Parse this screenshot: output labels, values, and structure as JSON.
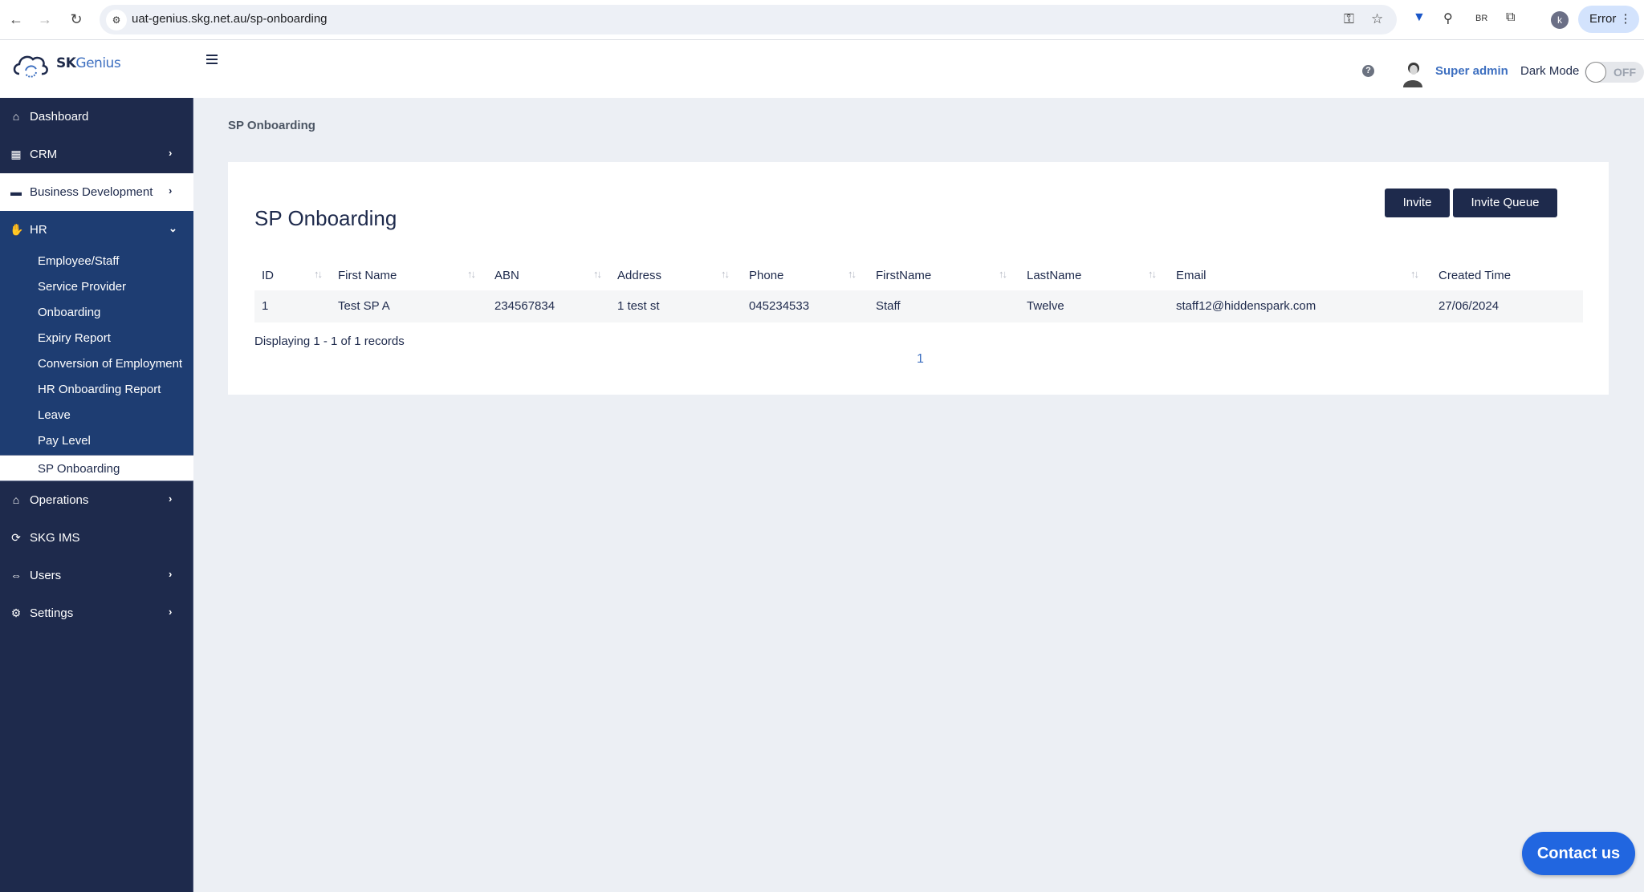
{
  "browser": {
    "url": "uat-genius.skg.net.au/sp-onboarding",
    "profile_initial": "k",
    "error_label": "Error",
    "ext_br_label": "BR"
  },
  "header": {
    "logo_text_a": "SK",
    "logo_text_b": "Genius",
    "help_glyph": "?",
    "user_name": "Super admin",
    "dark_mode_label": "Dark Mode",
    "dark_mode_state": "OFF"
  },
  "sidebar": {
    "items": [
      {
        "label": "Dashboard",
        "icon": "home-icon",
        "glyph": "⌂"
      },
      {
        "label": "CRM",
        "icon": "building-icon",
        "glyph": "▦",
        "chevron": "›"
      },
      {
        "label": "Business Development",
        "icon": "folder-icon",
        "glyph": "▬",
        "chevron": "›"
      },
      {
        "label": "HR",
        "icon": "handshake-icon",
        "glyph": "✋",
        "chevron": "⌄"
      },
      {
        "label": "Operations",
        "icon": "house-user-icon",
        "glyph": "⌂",
        "chevron": "›"
      },
      {
        "label": "SKG IMS",
        "icon": "sync-icon",
        "glyph": "⟳"
      },
      {
        "label": "Users",
        "icon": "users-icon",
        "glyph": "⇔",
        "chevron": "›"
      },
      {
        "label": "Settings",
        "icon": "gear-icon",
        "glyph": "⚙",
        "chevron": "›"
      }
    ],
    "hr_sub_items": [
      {
        "label": "Employee/Staff"
      },
      {
        "label": "Service Provider"
      },
      {
        "label": "Onboarding"
      },
      {
        "label": "Expiry Report"
      },
      {
        "label": "Conversion of Employment"
      },
      {
        "label": "HR Onboarding Report"
      },
      {
        "label": "Leave"
      },
      {
        "label": "Pay Level"
      },
      {
        "label": "SP Onboarding"
      }
    ]
  },
  "main": {
    "breadcrumb": "SP Onboarding",
    "title": "SP Onboarding",
    "buttons": {
      "invite": "Invite",
      "invite_queue": "Invite Queue"
    },
    "table": {
      "columns": [
        "ID",
        "First Name",
        "ABN",
        "Address",
        "Phone",
        "FirstName",
        "LastName",
        "Email",
        "Created Time"
      ],
      "sort_glyph": "↑↓",
      "rows": [
        [
          "1",
          "Test SP A",
          "234567834",
          "1 test st",
          "045234533",
          "Staff",
          "Twelve",
          "staff12@hiddenspark.com",
          "27/06/2024"
        ]
      ]
    },
    "records_text": "Displaying 1 - 1 of 1 records",
    "pagination": {
      "current_page": "1"
    }
  },
  "contact_button": "Contact us",
  "colors": {
    "sidebar_bg": "#1e2a4c",
    "hr_section_bg": "#1e3d72",
    "accent_blue": "#3d6fc0",
    "contact_blue": "#2166e0",
    "page_bg": "#eceff4"
  }
}
